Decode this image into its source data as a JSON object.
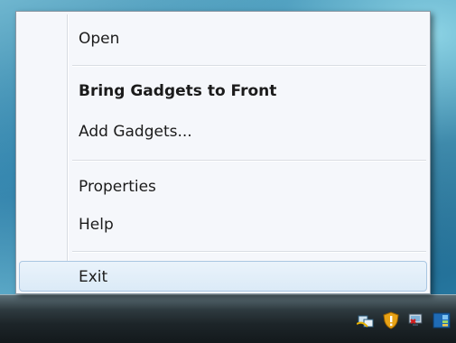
{
  "menu": {
    "items": [
      {
        "label": "Open"
      },
      {
        "label": "Bring Gadgets to Front"
      },
      {
        "label": "Add Gadgets..."
      },
      {
        "label": "Properties"
      },
      {
        "label": "Help"
      },
      {
        "label": "Exit"
      }
    ]
  },
  "tray": {
    "icons": [
      "network-icon",
      "security-alert-icon",
      "volume-icon",
      "sidebar-gadgets-icon"
    ]
  },
  "colors": {
    "menu_background": "#f5f7fb",
    "hover_background": "#dbeaf7",
    "hover_border": "#a9c6e2",
    "taskbar": "#1d2529"
  }
}
